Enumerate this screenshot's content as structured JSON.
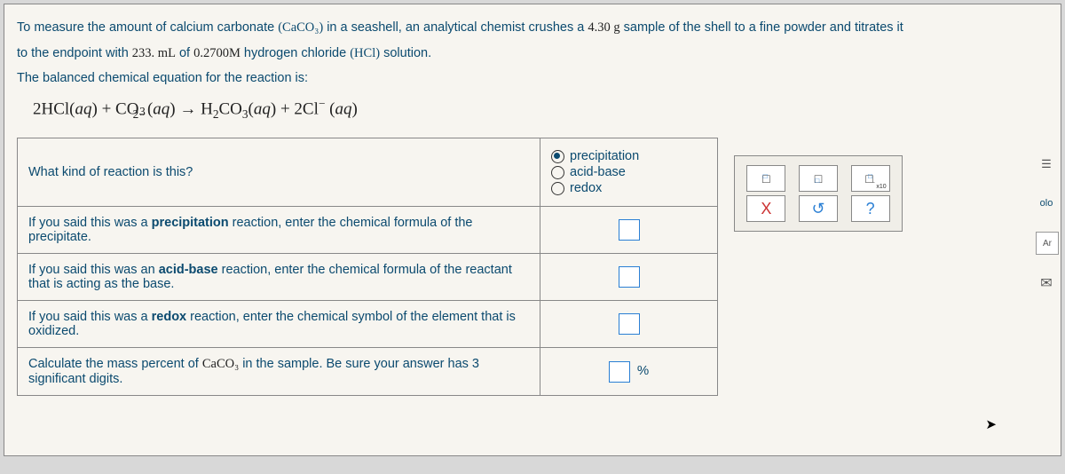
{
  "intro": {
    "p1_a": "To measure the amount of calcium carbonate ",
    "p1_formula": "(CaCO₃)",
    "p1_b": " in a seashell, an analytical chemist crushes a ",
    "p1_mass": "4.30 g",
    "p1_c": " sample of the shell to a fine powder and titrates it",
    "p2_a": "to the endpoint with ",
    "p2_vol": "233. mL",
    "p2_b": " of ",
    "p2_conc": "0.2700M",
    "p2_c": " hydrogen chloride ",
    "p2_hcl": "(HCl)",
    "p2_d": " solution.",
    "p3": "The balanced chemical equation for the reaction is:"
  },
  "equation": "2HCl(aq) + CO₃²⁻ (aq) → H₂CO₃(aq) + 2Cl⁻ (aq)",
  "q1": {
    "label": "What kind of reaction is this?",
    "opt1": "precipitation",
    "opt2": "acid-base",
    "opt3": "redox"
  },
  "q2": {
    "label_a": "If you said this was a ",
    "label_b": "precipitation",
    "label_c": " reaction, enter the chemical formula of the precipitate."
  },
  "q3": {
    "label_a": "If you said this was an ",
    "label_b": "acid-base",
    "label_c": " reaction, enter the chemical formula of the reactant that is acting as the base."
  },
  "q4": {
    "label_a": "If you said this was a ",
    "label_b": "redox",
    "label_c": " reaction, enter the chemical symbol of the element that is oxidized."
  },
  "q5": {
    "label_a": "Calculate the mass percent of ",
    "label_f": "CaCO₃",
    "label_b": " in the sample. Be sure your answer has 3 significant digits.",
    "unit": "%"
  },
  "pad": {
    "b1": "□",
    "b2": "□",
    "b3": "□",
    "x10": "x10",
    "bx": "X",
    "br": "↺",
    "bq": "?"
  },
  "icons": {
    "i2": "☰",
    "i3": "olo",
    "i4": "Ar",
    "i5": "✉"
  }
}
